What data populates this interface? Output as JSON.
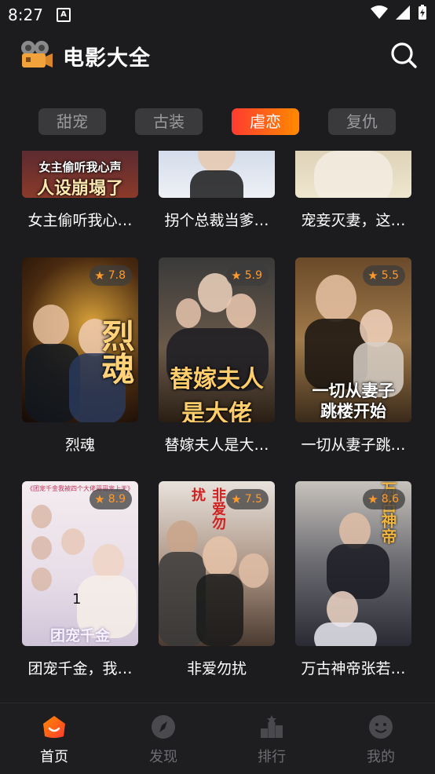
{
  "status_bar": {
    "time": "8:27",
    "notif_letter": "A"
  },
  "app_bar": {
    "title": "电影大全",
    "logo_icon": "film-camera-icon",
    "search_icon": "search-icon"
  },
  "tabs": [
    {
      "label": "甜宠",
      "active": false
    },
    {
      "label": "古装",
      "active": false
    },
    {
      "label": "虐恋",
      "active": true
    },
    {
      "label": "复仇",
      "active": false
    }
  ],
  "row_partial": {
    "items": [
      {
        "title": "女主偷听我心…",
        "poster_text_1": "女主偷听我心声",
        "poster_text_2": "人设崩塌了"
      },
      {
        "title": "拐个总裁当爹…"
      },
      {
        "title": "宠妾灭妻，这…"
      }
    ]
  },
  "row_1": {
    "items": [
      {
        "title": "烈魂",
        "rating": "7.8",
        "poster_text": "烈魂"
      },
      {
        "title": "替嫁夫人是大…",
        "rating": "5.9",
        "poster_text": "替嫁夫人是大佬"
      },
      {
        "title": "一切从妻子跳…",
        "rating": "5.5",
        "poster_text_1": "一切从妻子",
        "poster_text_2": "跳楼开始"
      }
    ]
  },
  "row_2": {
    "items": [
      {
        "title": "团宠千金，我…",
        "rating": "8.9",
        "poster_text_top": "《团宠千金我被四个大佬哥哥宠上天》",
        "poster_text_bottom": "团宠千金",
        "badge": "1"
      },
      {
        "title": "非爱勿扰",
        "rating": "7.5",
        "poster_text": "非爱勿扰"
      },
      {
        "title": "万古神帝张若…",
        "rating": "8.6",
        "poster_text": "万古神帝"
      }
    ]
  },
  "bottom_nav": [
    {
      "label": "首页",
      "icon": "home-face-icon",
      "active": true
    },
    {
      "label": "发现",
      "icon": "compass-icon",
      "active": false
    },
    {
      "label": "排行",
      "icon": "podium-icon",
      "active": false
    },
    {
      "label": "我的",
      "icon": "profile-face-icon",
      "active": false
    }
  ],
  "colors": {
    "accent_start": "#ff3b30",
    "accent_end": "#ff8a00",
    "background": "#1c1c1e",
    "rating": "#ff9a2e"
  }
}
